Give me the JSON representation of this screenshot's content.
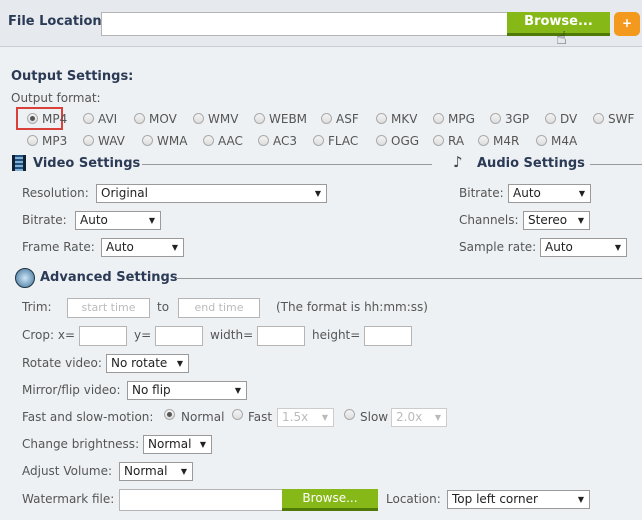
{
  "file_location": {
    "label": "File Location:",
    "value": "",
    "browse": "Browse...",
    "add": "+"
  },
  "output": {
    "title": "Output Settings:",
    "format_label": "Output format:",
    "selected": "MP4",
    "formats_row1": [
      "MP4",
      "AVI",
      "MOV",
      "WMV",
      "WEBM",
      "ASF",
      "MKV",
      "MPG",
      "3GP",
      "DV",
      "SWF"
    ],
    "formats_row2": [
      "MP3",
      "WAV",
      "WMA",
      "AAC",
      "AC3",
      "FLAC",
      "OGG",
      "RA",
      "M4R",
      "M4A"
    ]
  },
  "video": {
    "title": "Video Settings",
    "resolution_label": "Resolution:",
    "resolution": "Original",
    "bitrate_label": "Bitrate:",
    "bitrate": "Auto",
    "framerate_label": "Frame Rate:",
    "framerate": "Auto"
  },
  "audio": {
    "title": "Audio Settings",
    "bitrate_label": "Bitrate:",
    "bitrate": "Auto",
    "channels_label": "Channels:",
    "channels": "Stereo",
    "samplerate_label": "Sample rate:",
    "samplerate": "Auto"
  },
  "advanced": {
    "title": "Advanced Settings",
    "trim_label": "Trim:",
    "start_placeholder": "start time",
    "to": "to",
    "end_placeholder": "end time",
    "trim_note": "(The format is hh:mm:ss)",
    "crop_label": "Crop: x=",
    "crop_y": "y=",
    "crop_w": "width=",
    "crop_h": "height=",
    "rotate_label": "Rotate video:",
    "rotate": "No rotate",
    "mirror_label": "Mirror/flip video:",
    "mirror": "No flip",
    "speed_label": "Fast and slow-motion:",
    "normal": "Normal",
    "fast": "Fast",
    "fast_value": "1.5x",
    "slow": "Slow",
    "slow_value": "2.0x",
    "speed_selected": "Normal",
    "brightness_label": "Change brightness:",
    "brightness": "Normal",
    "volume_label": "Adjust Volume:",
    "volume": "Normal",
    "watermark_label": "Watermark file:",
    "watermark_value": "",
    "watermark_browse": "Browse...",
    "location_label": "Location:",
    "location": "Top left corner"
  },
  "colors": {
    "browse_green": "#86b817",
    "add_orange": "#f39a1e",
    "highlight_red": "#d9403a",
    "heading": "#2b3a55"
  }
}
